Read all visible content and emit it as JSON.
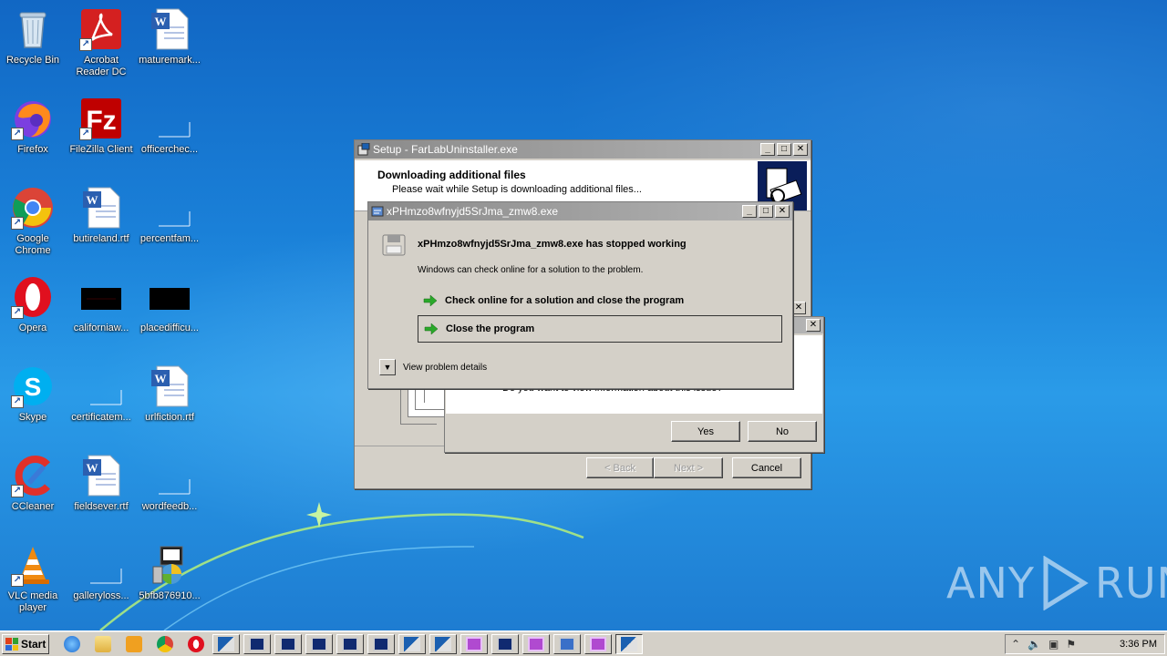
{
  "desktop": {
    "icons": [
      {
        "label": "Recycle Bin"
      },
      {
        "label": "Acrobat Reader DC"
      },
      {
        "label": "maturemark..."
      },
      {
        "label": "Firefox"
      },
      {
        "label": "FileZilla Client"
      },
      {
        "label": "officerchec..."
      },
      {
        "label": "Google Chrome"
      },
      {
        "label": "butireland.rtf"
      },
      {
        "label": "percentfam..."
      },
      {
        "label": "Opera"
      },
      {
        "label": "californiaw..."
      },
      {
        "label": "placedifficu..."
      },
      {
        "label": "Skype"
      },
      {
        "label": "certificatem..."
      },
      {
        "label": "urlfiction.rtf"
      },
      {
        "label": "CCleaner"
      },
      {
        "label": "fieldsever.rtf"
      },
      {
        "label": "wordfeedb..."
      },
      {
        "label": "VLC media player"
      },
      {
        "label": "galleryloss..."
      },
      {
        "label": "5bfb876910..."
      }
    ]
  },
  "setup_window": {
    "title": "Setup - FarLabUninstaller.exe",
    "heading": "Downloading additional files",
    "subheading": "Please wait while Setup is downloading additional files...",
    "back_label": "< Back",
    "next_label": "Next >",
    "cancel_label": "Cancel"
  },
  "confirm_dialog": {
    "body_text": "Do you want to view information about this issue?",
    "yes_label": "Yes",
    "no_label": "No"
  },
  "error_dialog": {
    "title": "xPHmzo8wfnyjd5SrJma_zmw8.exe",
    "message": "xPHmzo8wfnyjd5SrJma_zmw8.exe has stopped working",
    "info": "Windows can check online for a solution to the problem.",
    "option_check_online": "Check online for a solution and close the program",
    "option_close": "Close the program",
    "details_label": "View problem details"
  },
  "taskbar": {
    "start_label": "Start",
    "clock": "3:36 PM"
  },
  "watermark": {
    "left": "ANY",
    "right": "RUN"
  }
}
